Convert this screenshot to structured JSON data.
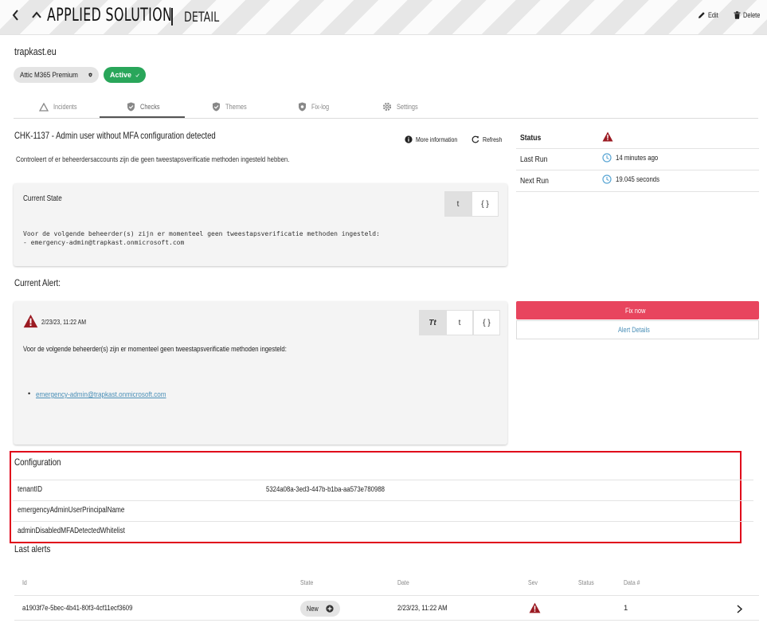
{
  "header": {
    "title": "APPLIED SOLUTION",
    "subtitle": "DETAIL",
    "edit_label": "Edit",
    "delete_label": "Delete"
  },
  "tenant": {
    "name": "trapkast.eu",
    "plan_badge": "Attic M365 Premium",
    "status_badge": "Active"
  },
  "tabs": [
    {
      "label": "Incidents",
      "icon": "warning-triangle-icon"
    },
    {
      "label": "Checks",
      "icon": "shield-check-icon"
    },
    {
      "label": "Themes",
      "icon": "shield-check-icon"
    },
    {
      "label": "Fix-log",
      "icon": "shield-gear-icon"
    },
    {
      "label": "Settings",
      "icon": "gear-icon"
    }
  ],
  "selected_tab": "Checks",
  "check": {
    "title": "CHK-1137 - Admin user without MFA configuration detected",
    "more_info_label": "More information",
    "refresh_label": "Refresh",
    "description": "Controleert of er beheerdersaccounts zijn die geen tweestapsverificatie methoden ingesteld hebben."
  },
  "current_state": {
    "label": "Current State",
    "view_options": [
      "t",
      "{ }"
    ],
    "selected_view": "t",
    "lines": [
      "Voor de volgende beheerder(s) zijn er momenteel geen tweestapsverificatie methoden ingesteld:",
      "- emergency-admin@trapkast.onmicrosoft.com"
    ]
  },
  "status_panel": {
    "status_label": "Status",
    "last_run_label": "Last Run",
    "last_run_value": "14 minutes ago",
    "next_run_label": "Next Run",
    "next_run_value": "19.045 seconds"
  },
  "current_alert": {
    "heading": "Current Alert:",
    "timestamp": "2/23/23, 11:22 AM",
    "view_options": [
      "Tt",
      "t",
      "{ }"
    ],
    "selected_view": "Tt",
    "message": "Voor de volgende beheerder(s) zijn er momenteel geen tweestapsverificatie methoden ingesteld:",
    "list_item": "emergency-admin@trapkast.onmicrosoft.com"
  },
  "actions": {
    "fix_now_label": "Fix now",
    "alert_details_label": "Alert Details"
  },
  "configuration": {
    "heading": "Configuration",
    "rows": [
      {
        "key": "tenantID",
        "value": "5324a08a-3ed3-447b-b1ba-aa573e780988"
      },
      {
        "key": "emergencyAdminUserPrincipalName",
        "value": ""
      },
      {
        "key": "adminDisabledMFADetectedWhitelist",
        "value": ""
      }
    ]
  },
  "last_alerts": {
    "heading": "Last alerts",
    "columns": [
      "Id",
      "State",
      "Date",
      "Sev",
      "Status",
      "Data #"
    ],
    "rows": [
      {
        "id": "a1903f7e-5bec-4b41-80f3-4cf11ecf3609",
        "state": "New",
        "date": "2/23/23, 11:22 AM",
        "sev": "critical-icon",
        "status": "",
        "data_count": "1"
      }
    ]
  },
  "colors": {
    "accent_red": "#e8455e",
    "active_green": "#29a65a",
    "severity_red": "#9b1a22",
    "link_blue": "#4a8fb7",
    "highlight_red": "#e0001a"
  }
}
